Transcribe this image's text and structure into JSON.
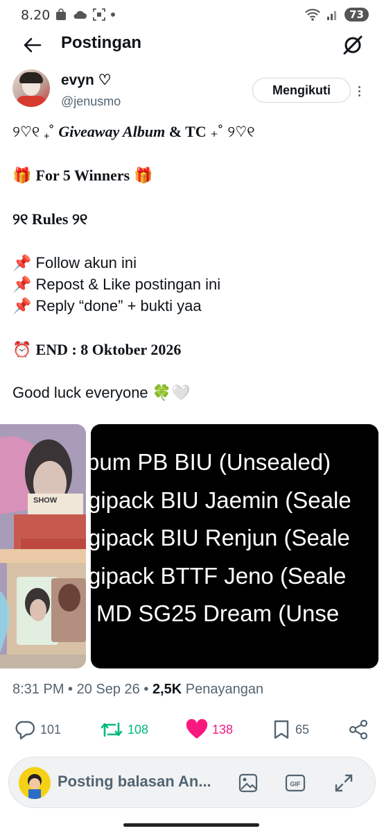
{
  "status": {
    "time": "8.20",
    "battery": "73"
  },
  "header": {
    "title": "Postingan"
  },
  "author": {
    "name": "evyn ♡",
    "handle": "@jenusmo",
    "follow_label": "Mengikuti"
  },
  "post": {
    "line1_prefix": "୨♡୧ ₊˚ ",
    "line1_main": "Giveaway Album",
    "line1_amp": " & TC ",
    "line1_suffix": "₊˚ ୨♡୧",
    "line2_text": "For 5 Winners",
    "line2_emoji": "🎁",
    "line3_text": "୨୧ Rules ୨୧",
    "rule1": "Follow akun ini",
    "rule2": "Repost  &  Like postingan ini",
    "rule3": "Reply “done” + bukti yaa",
    "rule_emoji": "📌",
    "end_emoji": "⏰",
    "end_text": "END : 8 Oktober 2026",
    "closing": "Good luck everyone",
    "closing_emoji": "🍀🤍"
  },
  "media": {
    "image2_lines": [
      "bum PB BIU (Unsealed)",
      "gipack BIU Jaemin (Seale",
      "gipack BIU Renjun (Seale",
      "gipack BTTF Jeno (Seale",
      "MD SG25 Dream (Unse"
    ],
    "sticker_text": "SHOW"
  },
  "meta": {
    "time": "8:31 PM",
    "sep1": " • ",
    "date": "20 Sep 26",
    "sep2": " • ",
    "views": "2,5K",
    "views_label": " Penayangan"
  },
  "actions": {
    "replies": "101",
    "reposts": "108",
    "likes": "138",
    "bookmarks": "65",
    "repost_color": "#00ba7c",
    "like_color": "#f91880"
  },
  "reply_bar": {
    "placeholder": "Posting balasan An..."
  }
}
